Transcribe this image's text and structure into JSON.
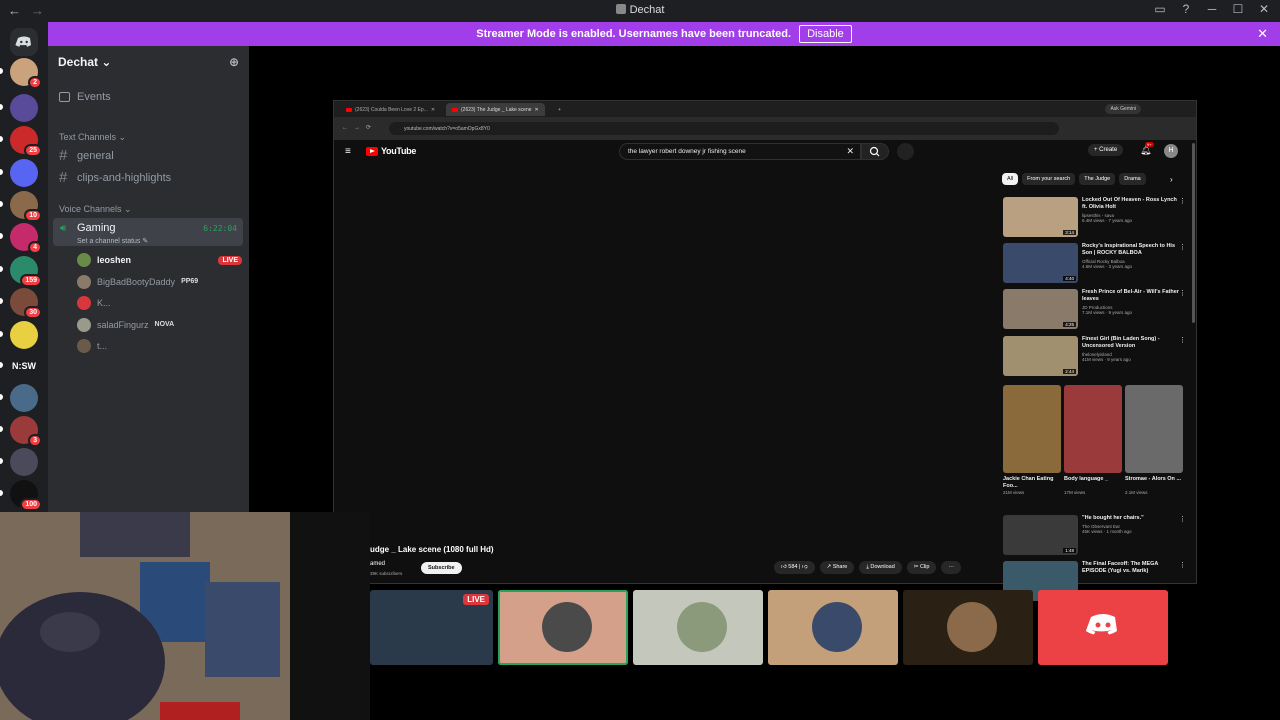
{
  "window": {
    "title": "Dechat"
  },
  "banner": {
    "text": "Streamer Mode is enabled. Usernames have been truncated.",
    "disable_label": "Disable"
  },
  "guilds": [
    {
      "name": "server-avatar-1",
      "color": "#caa27b",
      "badge": "2"
    },
    {
      "name": "server-2",
      "color": "#5a4a9a",
      "badge": ""
    },
    {
      "name": "server-3",
      "color": "#cc2a2a",
      "badge": "25"
    },
    {
      "name": "server-4",
      "color": "#5865f2",
      "badge": ""
    },
    {
      "name": "server-5",
      "color": "#8a6a4a",
      "badge": "10"
    },
    {
      "name": "server-6",
      "color": "#c52a6a",
      "badge": "4"
    },
    {
      "name": "server-7",
      "color": "#2a8a6a",
      "badge": "159"
    },
    {
      "name": "server-8",
      "color": "#7a4a3a",
      "badge": "30"
    },
    {
      "name": "server-9",
      "color": "#e8d040",
      "badge": ""
    },
    {
      "name": "server-nsw",
      "color": "#1e1f22",
      "badge": "",
      "label": "N:SW"
    },
    {
      "name": "server-11",
      "color": "#4a6a8a",
      "badge": ""
    },
    {
      "name": "server-12",
      "color": "#9a3a3a",
      "badge": "3"
    },
    {
      "name": "server-13",
      "color": "#4a4a5a",
      "badge": ""
    },
    {
      "name": "server-amd",
      "color": "#111",
      "badge": "100"
    }
  ],
  "sidebar": {
    "server_name": "Dechat",
    "events_label": "Events",
    "text_category": "Text Channels",
    "text_channels": [
      "general",
      "clips-and-highlights"
    ],
    "voice_category": "Voice Channels",
    "voice_channel": {
      "name": "Gaming",
      "status": "Set a channel status",
      "timer": "6:22:04"
    },
    "voice_users": [
      {
        "name": "leoshen",
        "live": "LIVE",
        "tag": "",
        "color": "#6a8a4a"
      },
      {
        "name": "BigBadBootyDaddy",
        "live": "",
        "tag": "PP69",
        "color": "#8a7a6a"
      },
      {
        "name": "K...",
        "live": "",
        "tag": "",
        "color": "#da373c"
      },
      {
        "name": "saladFingurz",
        "live": "",
        "tag": "NOVA",
        "color": "#9a9a8a"
      },
      {
        "name": "t...",
        "live": "",
        "tag": "",
        "color": "#6a5a4a"
      }
    ]
  },
  "browser": {
    "tabs": [
      "(2623) Coulda Been Love 2 Ep...",
      "(2623) The Judge _ Lake scene"
    ],
    "gemini": "Ask Gemini",
    "url": "youtube.com/watch?v=o5amOpGx8Y0",
    "yt_logo": "YouTube",
    "search_query": "the lawyer robert downey jr fishing scene",
    "create_label": "Create",
    "notif_count": "9+",
    "avatar_letter": "H",
    "chips": [
      "All",
      "From your search",
      "The Judge",
      "Drama"
    ],
    "recommendations": [
      {
        "title": "Locked Out Of Heaven - Ross Lynch ft. Olivia Holt",
        "channel": "lipsesthis - sava",
        "views": "6.4M views · 7 years ago",
        "duration": "3:14",
        "color": "#b8a080"
      },
      {
        "title": "Rocky's Inspirational Speech to His Son | ROCKY BALBOA",
        "channel": "Official Rocky Balboa",
        "views": "4.6M views · 3 years ago",
        "duration": "4:40",
        "color": "#3a4a6a"
      },
      {
        "title": "Fresh Prince of Bel-Air - Will's Father leaves",
        "channel": "JD Productions",
        "views": "7.1M views · 9 years ago",
        "duration": "4:25",
        "color": "#8a7a6a"
      },
      {
        "title": "Finest Girl (Bin Laden Song) - Uncensored Version",
        "channel": "thelonelyisland",
        "views": "41M views · 9 years ago",
        "duration": "2:44",
        "color": "#a09070"
      }
    ],
    "shorts": [
      {
        "title": "Jackie Chan Eating Foo...",
        "views": "21M views",
        "color": "#8a6a3a"
      },
      {
        "title": "Body language _",
        "views": "17M views",
        "color": "#9a3a3a"
      },
      {
        "title": "Stromae - Alors On ...",
        "views": "2.1M views",
        "color": "#6a6a6a"
      }
    ],
    "rec_after": [
      {
        "title": "\"He bought her chairs.\"",
        "channel": "The Observant Ear",
        "views": "45K views · 1 month ago",
        "duration": "1:48",
        "color": "#3a3a3a"
      },
      {
        "title": "The Final Faceoff: The MEGA EPISODE (Yugi vs. Marik)",
        "channel": "",
        "views": "",
        "duration": "",
        "color": "#3a5a6a"
      }
    ],
    "video_title": "udge _ Lake scene (1080 full Hd)",
    "channel": "amed",
    "subs": "39K subscribers",
    "subscribe": "Subscribe",
    "actions": [
      "584",
      "",
      "Share",
      "Download",
      "Clip",
      "···"
    ]
  },
  "tiles": [
    {
      "name": "stream-tile",
      "color": "#2a3a4a",
      "live": "LIVE",
      "circle": ""
    },
    {
      "name": "user-tile-speaking",
      "color": "#d4a08a",
      "live": "",
      "circle": "#4a4a4a"
    },
    {
      "name": "user-tile-2",
      "color": "#c4c8bc",
      "live": "",
      "circle": "#8a9a7a"
    },
    {
      "name": "user-tile-3",
      "color": "#c4a07a",
      "live": "",
      "circle": "#3a4a6a"
    },
    {
      "name": "user-tile-4",
      "color": "#2a2014",
      "live": "",
      "circle": "#8a6a4a"
    },
    {
      "name": "user-tile-discord",
      "color": "#ed4245",
      "live": "",
      "circle": ""
    }
  ],
  "colors": {
    "accent": "#5865f2",
    "banner": "#a23dea",
    "green": "#23a55a",
    "live": "#da373c"
  }
}
